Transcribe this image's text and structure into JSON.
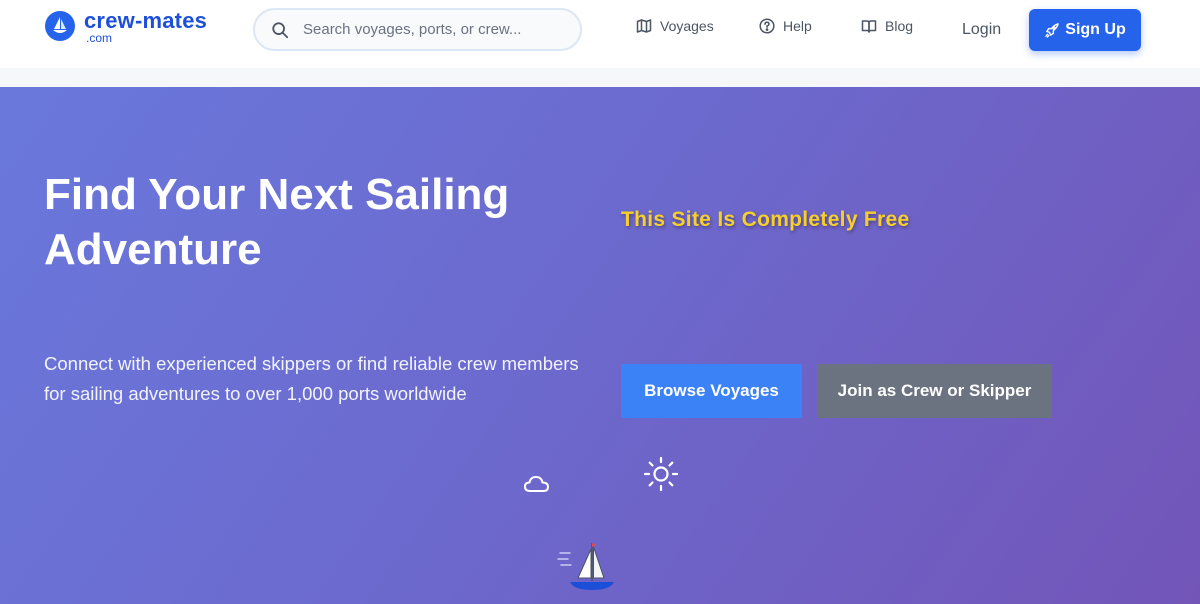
{
  "brand": {
    "name": "crew-mates",
    "tld": ".com"
  },
  "search": {
    "placeholder": "Search voyages, ports, or crew..."
  },
  "nav": {
    "voyages": "Voyages",
    "help": "Help",
    "blog": "Blog",
    "login": "Login",
    "signup": "Sign Up"
  },
  "hero": {
    "title": "Find Your Next Sailing Adventure",
    "subtitle": "Connect with experienced skippers or find reliable crew members for sailing adventures to over 1,000 ports worldwide",
    "free_note": "This Site Is Completely Free",
    "browse_button": "Browse Voyages",
    "join_button": "Join as Crew or Skipper"
  },
  "icons": {
    "logo": "sailboat-logo-icon",
    "search": "search-icon",
    "voyages": "map-icon",
    "help": "question-circle-icon",
    "blog": "book-icon",
    "signup": "rocket-icon",
    "weather_cloud": "cloud-icon",
    "weather_sun": "sun-icon",
    "boat": "sailboat-icon"
  },
  "colors": {
    "brand": "#1e4fd8",
    "primary_button": "#2563eb",
    "browse_button": "#3b82f6",
    "join_button": "#6b7280",
    "hero_gradient_start": "#6a78dc",
    "hero_gradient_end": "#7355b8",
    "free_note": "#f6d02a"
  }
}
